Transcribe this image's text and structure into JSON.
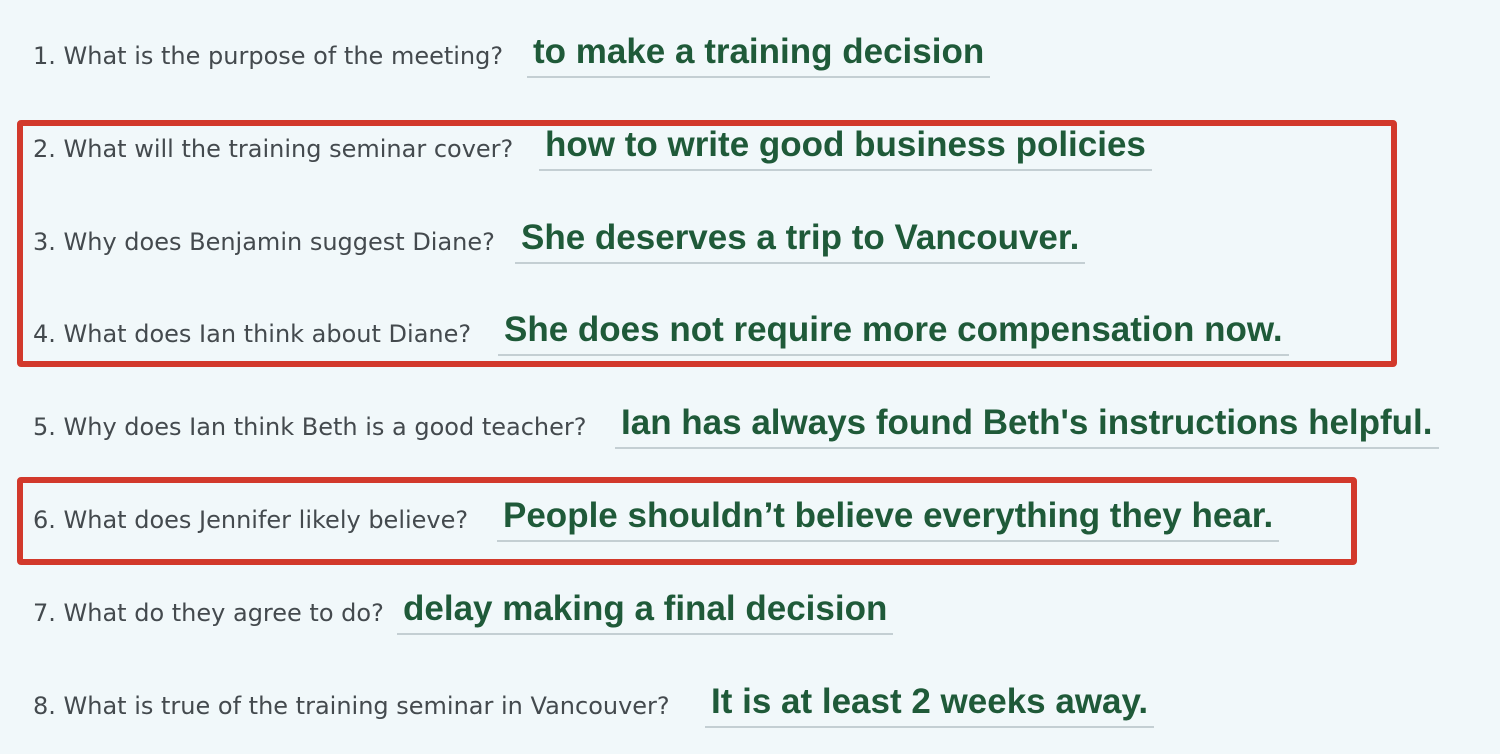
{
  "questions": [
    {
      "number": "1.",
      "text": "1. What is the purpose of the meeting?",
      "answer": "to make a training decision"
    },
    {
      "number": "2.",
      "text": "2. What will the training seminar cover?",
      "answer": "how to write good business policies"
    },
    {
      "number": "3.",
      "text": "3. Why does Benjamin suggest Diane?",
      "answer": "She deserves a trip to Vancouver."
    },
    {
      "number": "4.",
      "text": "4. What does Ian think about Diane?",
      "answer": "She does not require more compensation now."
    },
    {
      "number": "5.",
      "text": "5. Why does Ian think Beth is a good teacher?",
      "answer": "Ian has always found Beth's instructions helpful."
    },
    {
      "number": "6.",
      "text": "6. What does Jennifer likely believe?",
      "answer": "People shouldn’t believe everything they hear."
    },
    {
      "number": "7.",
      "text": "7. What do they agree to do?",
      "answer": "delay making a final decision"
    },
    {
      "number": "8.",
      "text": "8. What is true of the training seminar in Vancouver?",
      "answer": "It is at least 2 weeks away."
    }
  ],
  "highlights": [
    {
      "label": "questions 2-4",
      "color": "#d2392b"
    },
    {
      "label": "question 6",
      "color": "#d2392b"
    }
  ],
  "colors": {
    "background": "#f1f8fa",
    "question_text": "#444a4e",
    "answer_text": "#1f5a39",
    "answer_underline": "#c4cfd3",
    "highlight_border": "#d2392b"
  }
}
